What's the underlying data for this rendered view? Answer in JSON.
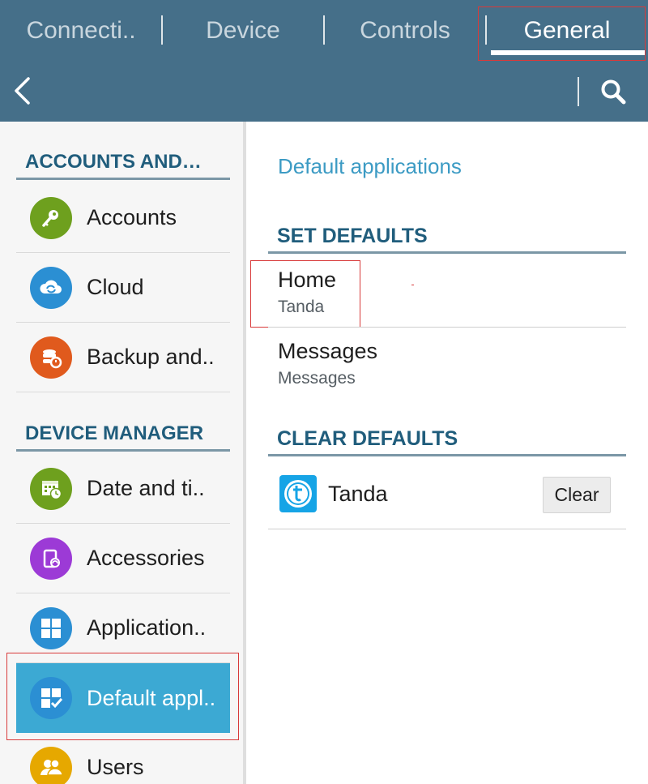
{
  "tabs": [
    {
      "label": "Connecti.."
    },
    {
      "label": "Device"
    },
    {
      "label": "Controls"
    },
    {
      "label": "General"
    }
  ],
  "active_tab": "General",
  "toolbar": {
    "back_icon": "chevron-left-icon",
    "search_icon": "search-icon"
  },
  "sidebar": {
    "sections": [
      {
        "title": "ACCOUNTS AND…",
        "items": [
          {
            "label": "Accounts",
            "icon": "key-icon",
            "color": "#6ea01e"
          },
          {
            "label": "Cloud",
            "icon": "cloud-sync-icon",
            "color": "#2b8fd3"
          },
          {
            "label": "Backup and..",
            "icon": "backup-icon",
            "color": "#e05a1d"
          }
        ]
      },
      {
        "title": "DEVICE MANAGER",
        "items": [
          {
            "label": "Date and ti..",
            "icon": "calendar-clock-icon",
            "color": "#6ea01e"
          },
          {
            "label": "Accessories",
            "icon": "accessory-icon",
            "color": "#9c3ad6"
          },
          {
            "label": "Application..",
            "icon": "apps-grid-icon",
            "color": "#2b8fd3"
          },
          {
            "label": "Default appl..",
            "icon": "default-apps-icon",
            "color": "#2b8fd3",
            "selected": true
          },
          {
            "label": "Users",
            "icon": "users-icon",
            "color": "#e6a800"
          }
        ]
      }
    ]
  },
  "main": {
    "title": "Default applications",
    "set_defaults": {
      "header": "SET DEFAULTS",
      "items": [
        {
          "primary": "Home",
          "secondary": "Tanda"
        },
        {
          "primary": "Messages",
          "secondary": "Messages"
        }
      ]
    },
    "clear_defaults": {
      "header": "CLEAR DEFAULTS",
      "app_name": "Tanda",
      "app_icon": "tanda-app-icon",
      "button_label": "Clear"
    }
  }
}
